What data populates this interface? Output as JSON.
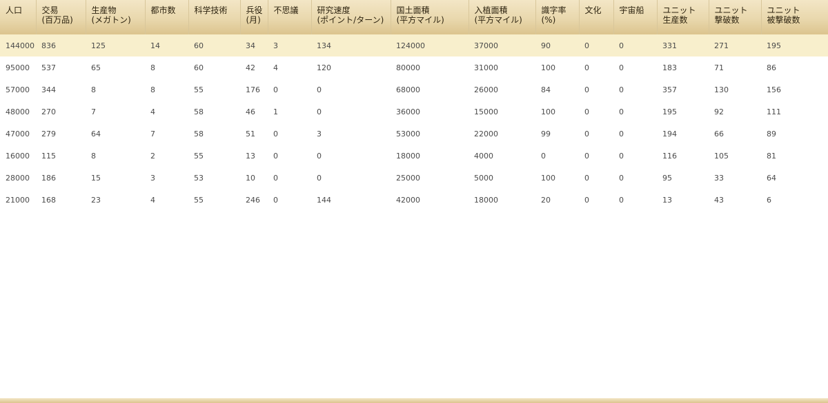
{
  "table": {
    "columns": [
      {
        "key": "population",
        "line1": "人口",
        "line2": ""
      },
      {
        "key": "trade",
        "line1": "交易",
        "line2": "(百万品)"
      },
      {
        "key": "production",
        "line1": "生産物",
        "line2": "(メガトン)"
      },
      {
        "key": "cities",
        "line1": "都市数",
        "line2": ""
      },
      {
        "key": "technology",
        "line1": "科学技術",
        "line2": ""
      },
      {
        "key": "military",
        "line1": "兵役",
        "line2": "(月)"
      },
      {
        "key": "wonders",
        "line1": "不思議",
        "line2": ""
      },
      {
        "key": "research",
        "line1": "研究速度",
        "line2": "(ポイント/ターン)"
      },
      {
        "key": "land",
        "line1": "国土面積",
        "line2": "(平方マイル)"
      },
      {
        "key": "settled",
        "line1": "入植面積",
        "line2": "(平方マイル)"
      },
      {
        "key": "literacy",
        "line1": "識字率",
        "line2": "(%)"
      },
      {
        "key": "culture",
        "line1": "文化",
        "line2": ""
      },
      {
        "key": "spaceship",
        "line1": "宇宙船",
        "line2": ""
      },
      {
        "key": "units_built",
        "line1": "ユニット",
        "line2": "生産数"
      },
      {
        "key": "units_killed",
        "line1": "ユニット",
        "line2": "撃破数"
      },
      {
        "key": "units_lost",
        "line1": "ユニット",
        "line2": "被撃破数"
      }
    ],
    "rows": [
      [
        "144000",
        "836",
        "125",
        "14",
        "60",
        "34",
        "3",
        "134",
        "124000",
        "37000",
        "90",
        "0",
        "0",
        "331",
        "271",
        "195"
      ],
      [
        "95000",
        "537",
        "65",
        "8",
        "60",
        "42",
        "4",
        "120",
        "80000",
        "31000",
        "100",
        "0",
        "0",
        "183",
        "71",
        "86"
      ],
      [
        "57000",
        "344",
        "8",
        "8",
        "55",
        "176",
        "0",
        "0",
        "68000",
        "26000",
        "84",
        "0",
        "0",
        "357",
        "130",
        "156"
      ],
      [
        "48000",
        "270",
        "7",
        "4",
        "58",
        "46",
        "1",
        "0",
        "36000",
        "15000",
        "100",
        "0",
        "0",
        "195",
        "92",
        "111"
      ],
      [
        "47000",
        "279",
        "64",
        "7",
        "58",
        "51",
        "0",
        "3",
        "53000",
        "22000",
        "99",
        "0",
        "0",
        "194",
        "66",
        "89"
      ],
      [
        "16000",
        "115",
        "8",
        "2",
        "55",
        "13",
        "0",
        "0",
        "18000",
        "4000",
        "0",
        "0",
        "0",
        "116",
        "105",
        "81"
      ],
      [
        "28000",
        "186",
        "15",
        "3",
        "53",
        "10",
        "0",
        "0",
        "25000",
        "5000",
        "100",
        "0",
        "0",
        "95",
        "33",
        "64"
      ],
      [
        "21000",
        "168",
        "23",
        "4",
        "55",
        "246",
        "0",
        "144",
        "42000",
        "18000",
        "20",
        "0",
        "0",
        "13",
        "43",
        "6"
      ]
    ],
    "selected_row": 0
  },
  "colors": {
    "header_top": "#f3e6c6",
    "header_bottom": "#dcc48e",
    "selected_row": "#f8efcc",
    "text": "#4a4a4a"
  }
}
